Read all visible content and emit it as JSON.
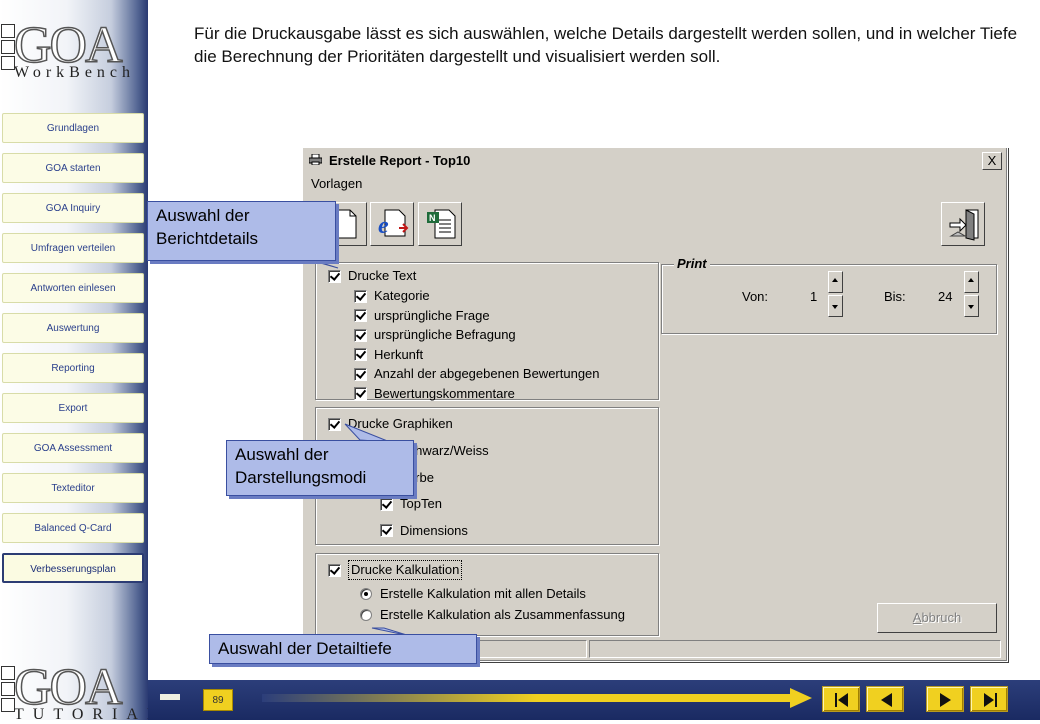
{
  "intro_text": "Für die Druckausgabe lässt es sich auswählen, welche Details dargestellt werden sollen, und in welcher Tiefe die Berechnung der Prioritäten dargestellt und visualisiert werden soll.",
  "logo": {
    "letters": "GOA",
    "top_subtitle": "WorkBench",
    "bottom_subtitle": "TUTORIAL"
  },
  "sidebar": {
    "items": [
      {
        "label": "Grundlagen"
      },
      {
        "label": "GOA  starten"
      },
      {
        "label": "GOA  Inquiry"
      },
      {
        "label": "Umfragen verteilen"
      },
      {
        "label": "Antworten einlesen"
      },
      {
        "label": "Auswertung"
      },
      {
        "label": "Reporting"
      },
      {
        "label": "Export"
      },
      {
        "label": "GOA  Assessment"
      },
      {
        "label": "Texteditor"
      },
      {
        "label": "Balanced Q-Card"
      },
      {
        "label": "Verbesserungsplan",
        "active": true
      }
    ]
  },
  "dialog": {
    "title": "Erstelle Report - Top10",
    "close_symbol": "X",
    "menu": {
      "vorlagen": "Vorlagen"
    },
    "text_group": {
      "main": {
        "label": "Drucke Text",
        "checked": true
      },
      "options": [
        {
          "label": "Kategorie",
          "checked": true
        },
        {
          "label": "ursprüngliche Frage",
          "checked": true
        },
        {
          "label": "ursprüngliche Befragung",
          "checked": true
        },
        {
          "label": "Herkunft",
          "checked": true
        },
        {
          "label": "Anzahl der abgegebenen Bewertungen",
          "checked": true
        },
        {
          "label": "Bewertungskommentare",
          "checked": true
        }
      ]
    },
    "graphics_group": {
      "main": {
        "label": "Drucke Graphiken",
        "checked": true
      },
      "options": [
        {
          "label": "Schwarz/Weiss",
          "checked": false
        },
        {
          "label": "Farbe",
          "checked": false
        },
        {
          "label": "TopTen",
          "checked": true
        },
        {
          "label": "Dimensions",
          "checked": true
        }
      ]
    },
    "calc_group": {
      "main": {
        "label": "Drucke Kalkulation",
        "checked": true
      },
      "options": [
        {
          "label": "Erstelle Kalkulation mit allen Details",
          "selected": true
        },
        {
          "label": "Erstelle Kalkulation als Zusammenfassung",
          "selected": false
        }
      ]
    },
    "print_group": {
      "legend": "Print",
      "von_label": "Von:",
      "von_value": "1",
      "bis_label": "Bis:",
      "bis_value": "24"
    },
    "abbruch_label": "Abbruch"
  },
  "callouts": {
    "berichtdetails": "Auswahl der Berichtdetails",
    "darstellungsmodi": "Auswahl der Darstellungsmodi",
    "detailtiefe": "Auswahl der Detailtiefe"
  },
  "footer": {
    "page_number": "89"
  },
  "colors": {
    "sidebar_dark": "#2a3a72",
    "nav_button_bg": "#fcfce6",
    "nav_text": "#2a3f8c",
    "dialog_face": "#d4d0c8",
    "callout_bg": "#aebbe8",
    "footer_button": "#f0d020"
  }
}
